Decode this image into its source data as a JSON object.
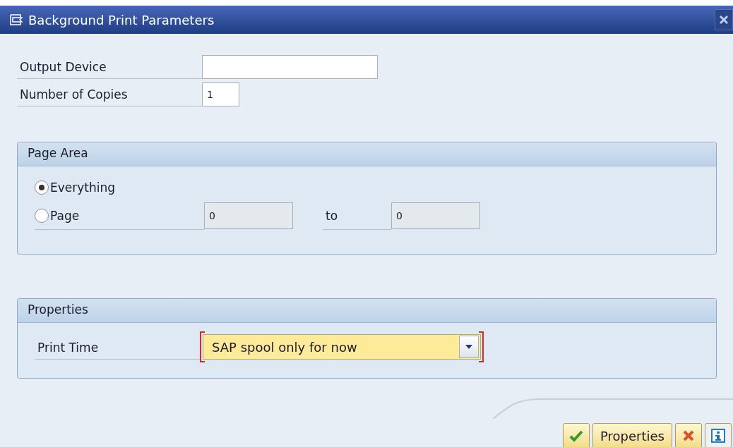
{
  "window": {
    "title": "Background Print Parameters"
  },
  "fields": [
    {
      "label": "Output Device"
    },
    {
      "label": "Number of Copies",
      "value": "1"
    }
  ],
  "page_area": {
    "title": "Page Area",
    "options": [
      {
        "label": "Everything",
        "selected": true
      },
      {
        "label": "Page",
        "selected": false
      }
    ],
    "from": "0",
    "to_label": "to",
    "to": "0"
  },
  "properties": {
    "title": "Properties",
    "print_time": {
      "label": "Print Time",
      "value": "SAP spool only for now",
      "required": true
    }
  },
  "buttons": [
    {
      "kind": "confirm"
    },
    {
      "kind": "text",
      "label": "Properties"
    },
    {
      "kind": "cancel"
    },
    {
      "kind": "info"
    }
  ]
}
